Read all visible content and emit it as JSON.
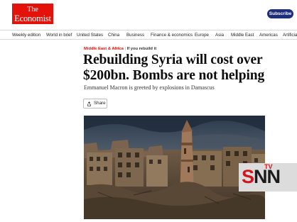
{
  "brand": {
    "logo_line1": "The",
    "logo_line2": "Economist",
    "subscribe_label": "Subscribe"
  },
  "nav": {
    "items": [
      "Weekly edition",
      "World in brief",
      "United States",
      "China",
      "Business",
      "Finance & economics",
      "Europe",
      "Asia",
      "Middle East",
      "Americas",
      "Artificial"
    ]
  },
  "article": {
    "section": "Middle East & Africa",
    "divider": " | ",
    "topic": "If you rebuild it",
    "headline": "Rebuilding Syria will cost over $200bn. Bombs are not helping",
    "subhead": "Emmanuel Macron is greeted by explosions in Damascus",
    "share_label": "Share"
  },
  "watermark": {
    "s": "S",
    "nn": "NN",
    "tv": "TV"
  },
  "icons": [
    "share-icon"
  ],
  "colors": {
    "brand_red": "#e3120b",
    "subscribe_blue": "#1f2e7a"
  }
}
